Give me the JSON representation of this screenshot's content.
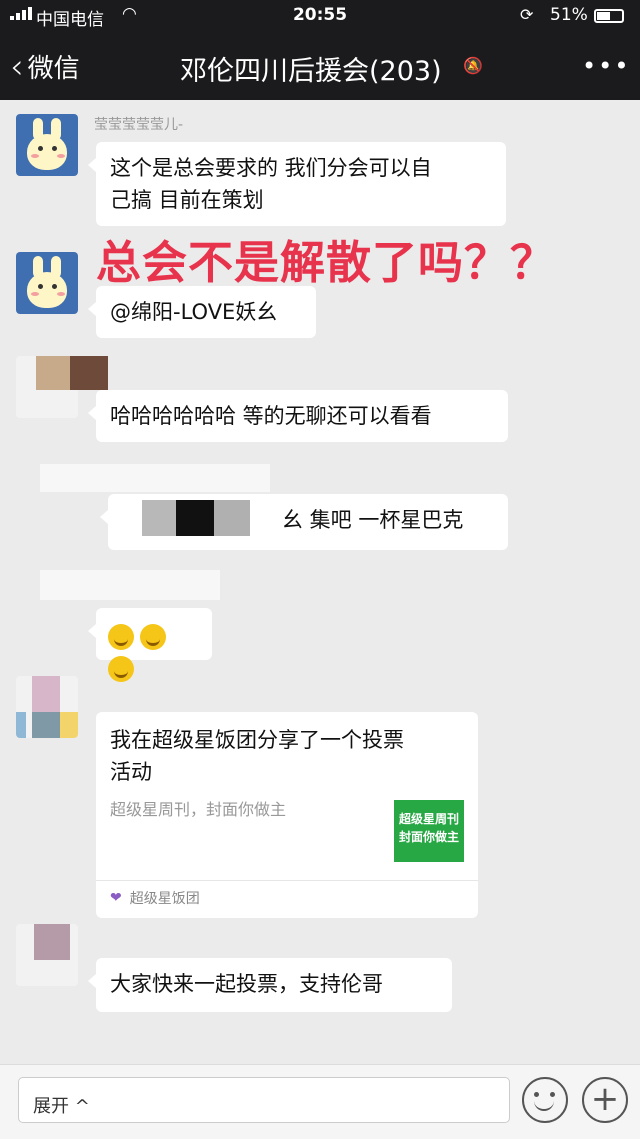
{
  "status_bar": {
    "carrier": "中国电信",
    "time": "20:55",
    "battery_pct": "51%",
    "battery_level": 0.51
  },
  "nav": {
    "back_label": "微信",
    "chat_title": "邓伦四川后援会(203)"
  },
  "messages": [
    {
      "sender": "莹莹莹莹莹儿-",
      "text_line1": "这个是总会要求的 我们分会可以自",
      "text_line2": "己搞 目前在策划"
    },
    {
      "text": "@绵阳-LOVE妖幺"
    },
    {
      "text": "哈哈哈哈哈哈 等的无聊还可以看看"
    },
    {
      "text": "幺 集吧 一杯星巴克"
    },
    {
      "emoji_count": 3
    },
    {
      "card_title_line1": "我在超级星饭团分享了一个投票",
      "card_title_line2": "活动",
      "card_desc": "超级星周刊，封面你做主",
      "thumb_line1": "超级星周刊",
      "thumb_line2": "封面你做主",
      "source": "超级星饭团"
    },
    {
      "text": "大家快来一起投票，支持伦哥"
    }
  ],
  "overlay_text": "总会不是解散了吗？？",
  "input_bar": {
    "expand_label": "展开 ^",
    "plus": "+"
  },
  "colors": {
    "nav_bg": "#1b1b1d",
    "chat_bg": "#ebebeb",
    "overlay_red": "#e8334d",
    "thumb_green": "#28a745"
  }
}
